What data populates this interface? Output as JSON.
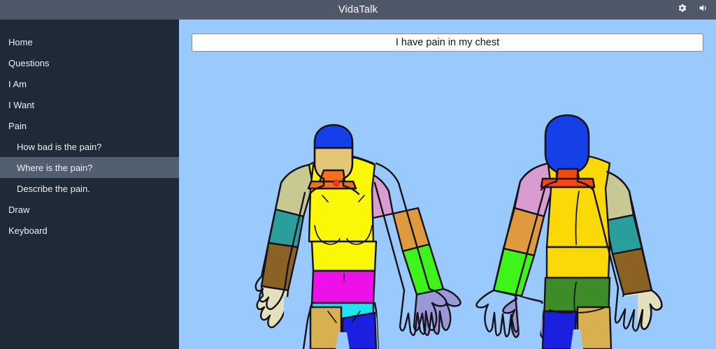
{
  "header": {
    "title": "VidaTalk",
    "icons": [
      {
        "name": "gear-icon",
        "label": "Settings"
      },
      {
        "name": "volume-icon",
        "label": "Sound"
      }
    ]
  },
  "sidebar": {
    "items": [
      {
        "label": "Home",
        "level": 0,
        "selected": false
      },
      {
        "label": "Questions",
        "level": 0,
        "selected": false
      },
      {
        "label": "I Am",
        "level": 0,
        "selected": false
      },
      {
        "label": "I Want",
        "level": 0,
        "selected": false
      },
      {
        "label": "Pain",
        "level": 0,
        "selected": false
      },
      {
        "label": "How bad is the pain?",
        "level": 1,
        "selected": false
      },
      {
        "label": "Where is the pain?",
        "level": 1,
        "selected": true
      },
      {
        "label": "Describe the pain.",
        "level": 1,
        "selected": false
      },
      {
        "label": "Draw",
        "level": 0,
        "selected": false
      },
      {
        "label": "Keyboard",
        "level": 0,
        "selected": false
      }
    ]
  },
  "main": {
    "phrase": "I have pain in my chest",
    "background_color": "#99c9fd",
    "body_map": {
      "views": [
        {
          "name": "front-body-view",
          "label": "Front view"
        },
        {
          "name": "back-body-view",
          "label": "Back view"
        }
      ],
      "marker": {
        "name": "pain-marker",
        "color": "#f03c14",
        "view": "front",
        "region": "chest"
      },
      "regions": [
        {
          "name": "scalp",
          "view": "front",
          "color": "#1540e8"
        },
        {
          "name": "face",
          "view": "front",
          "color": "#e3c678"
        },
        {
          "name": "neck",
          "view": "front",
          "color": "#f7701a"
        },
        {
          "name": "chest-abdomen",
          "view": "front",
          "color": "#faf707"
        },
        {
          "name": "left-shoulder",
          "view": "front",
          "color": "#c8c893"
        },
        {
          "name": "left-upper-arm",
          "view": "front",
          "color": "#2a9d9d"
        },
        {
          "name": "left-forearm",
          "view": "front",
          "color": "#8b6124"
        },
        {
          "name": "left-hand",
          "view": "front",
          "color": "#e4e0bd"
        },
        {
          "name": "right-shoulder",
          "view": "front",
          "color": "#d99bd0"
        },
        {
          "name": "right-upper-arm",
          "view": "front",
          "color": "#e09a3e"
        },
        {
          "name": "right-forearm",
          "view": "front",
          "color": "#3ef41a"
        },
        {
          "name": "right-hand",
          "view": "front",
          "color": "#9a98d6"
        },
        {
          "name": "lower-abdomen",
          "view": "front",
          "color": "#ed10e8"
        },
        {
          "name": "pelvis",
          "view": "front",
          "color": "#1be5f0"
        },
        {
          "name": "left-thigh",
          "view": "front",
          "color": "#d8b050"
        },
        {
          "name": "right-thigh",
          "view": "front",
          "color": "#1b20e0"
        },
        {
          "name": "head-back",
          "view": "back",
          "color": "#1540e8"
        },
        {
          "name": "neck-back",
          "view": "back",
          "color": "#f4480f"
        },
        {
          "name": "upper-back",
          "view": "back",
          "color": "#fad907"
        },
        {
          "name": "left-shoulder-back",
          "view": "back",
          "color": "#d99bd0"
        },
        {
          "name": "left-upper-arm-back",
          "view": "back",
          "color": "#e09a3e"
        },
        {
          "name": "left-forearm-back",
          "view": "back",
          "color": "#3ef41a"
        },
        {
          "name": "left-hand-back",
          "view": "back",
          "color": "#9a98d6"
        },
        {
          "name": "right-shoulder-back",
          "view": "back",
          "color": "#c8c893"
        },
        {
          "name": "right-upper-arm-back",
          "view": "back",
          "color": "#2a9d9d"
        },
        {
          "name": "right-forearm-back",
          "view": "back",
          "color": "#8b6124"
        },
        {
          "name": "right-hand-back",
          "view": "back",
          "color": "#e4e0bd"
        },
        {
          "name": "buttocks",
          "view": "back",
          "color": "#3e8c27"
        },
        {
          "name": "left-thigh-back",
          "view": "back",
          "color": "#1b20e0"
        },
        {
          "name": "right-thigh-back",
          "view": "back",
          "color": "#d8b050"
        }
      ]
    }
  }
}
